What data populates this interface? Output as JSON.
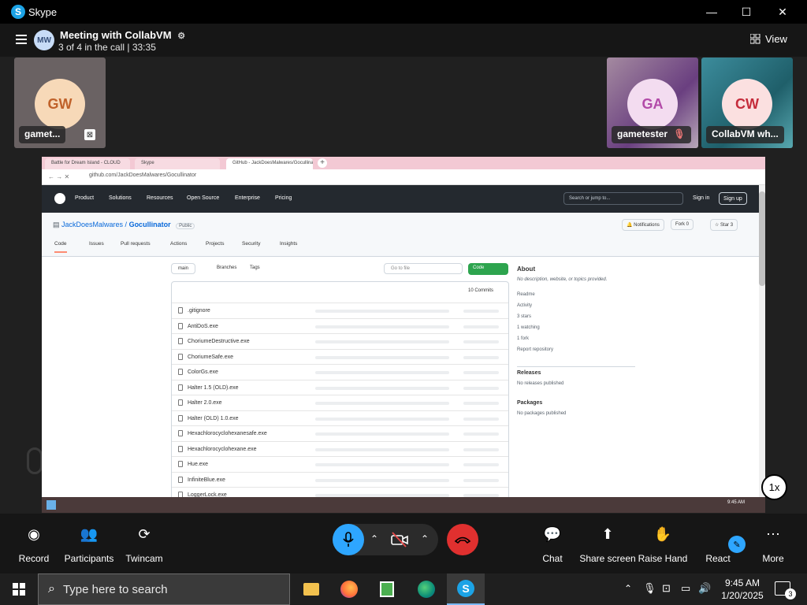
{
  "window": {
    "app_title": "Skype",
    "min": "—",
    "max": "☐",
    "close": "✕"
  },
  "call": {
    "initials": "MW",
    "title": "Meeting with CollabVM",
    "subtitle": "3 of 4 in the call | 33:35",
    "view_label": "View"
  },
  "participants": [
    {
      "initials": "GW",
      "name": "gamet...",
      "bg": "#6a6263",
      "avatar_bg": "#f7d9b8",
      "avatar_fg": "#c0622a"
    },
    {
      "initials": "GA",
      "name": "gametester",
      "bg": "#8a6a8a",
      "avatar_bg": "#f3dcf0",
      "avatar_fg": "#b24aa8"
    },
    {
      "initials": "CW",
      "name": "CollabVM wh...",
      "bg": "#2f7a86",
      "avatar_bg": "#fbe0e0",
      "avatar_fg": "#c52c3b"
    }
  ],
  "shared": {
    "tabs": [
      "Battle for Dream Island - CLOUD",
      "Skype",
      "GitHub - JackDoesMalwares/Gocullinator"
    ],
    "url": "github.com/JackDoesMalwares/Gocullinator",
    "nav": [
      "Product",
      "Solutions",
      "Resources",
      "Open Source",
      "Enterprise",
      "Pricing"
    ],
    "search_placeholder": "Search or jump to...",
    "signin": "Sign in",
    "signup": "Sign up",
    "repo_owner": "JackDoesMalwares",
    "repo_name": "Gocullinator",
    "visibility": "Public",
    "notifications": "Notifications",
    "fork": "Fork",
    "star": "Star",
    "fork_count": "0",
    "star_count": "3",
    "repo_tabs": [
      "Code",
      "Issues",
      "Pull requests",
      "Actions",
      "Projects",
      "Security",
      "Insights"
    ],
    "branch": "main",
    "branches": "Branches",
    "tags": "Tags",
    "go_to_file": "Go to file",
    "code_btn": "Code",
    "commits": "10 Commits",
    "files": [
      ".gitignore",
      "AntiDoS.exe",
      "ChoriumeDestructive.exe",
      "ChoriumeSafe.exe",
      "ColorGs.exe",
      "Halter 1.5 (OLD).exe",
      "Halter 2.0.exe",
      "Halter (OLD) 1.0.exe",
      "Hexachlorocyclohexanesafe.exe",
      "Hexachlorocyclohexane.exe",
      "Hue.exe",
      "InfiniteBlue.exe",
      "LoggerLock.exe"
    ],
    "about_title": "About",
    "about_desc": "No description, website, or topics provided.",
    "about_items": [
      "Readme",
      "Activity",
      "3 stars",
      "1 watching",
      "1 fork"
    ],
    "report": "Report repository",
    "releases": "Releases",
    "releases_desc": "No releases published",
    "packages": "Packages",
    "packages_desc": "No packages published",
    "inner_clock": "9:45 AM"
  },
  "speed": "1x",
  "controls": {
    "record": "Record",
    "participants": "Participants",
    "twincam": "Twincam",
    "chat": "Chat",
    "share": "Share screen",
    "raise": "Raise Hand",
    "react": "React",
    "more": "More"
  },
  "taskbar": {
    "search": "Type here to search",
    "time": "9:45 AM",
    "date": "1/20/2025",
    "notif_count": "3"
  }
}
